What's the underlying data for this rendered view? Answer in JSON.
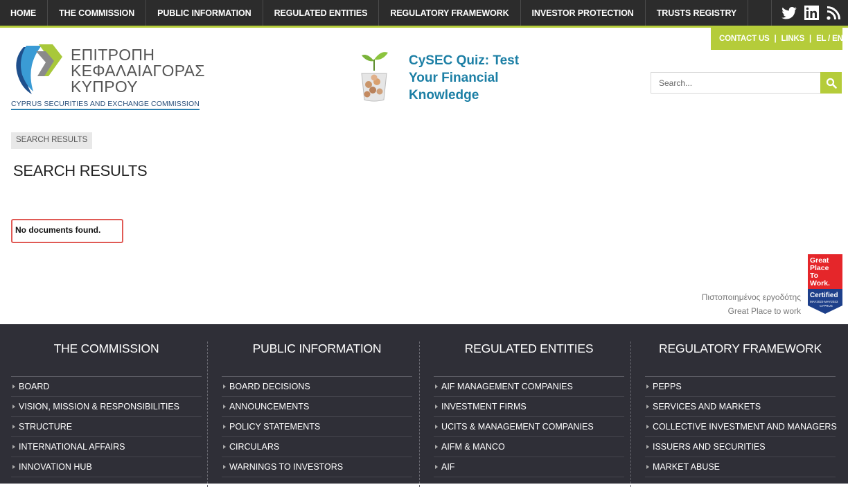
{
  "nav": {
    "items": [
      "HOME",
      "THE COMMISSION",
      "PUBLIC INFORMATION",
      "REGULATED ENTITIES",
      "REGULATORY FRAMEWORK",
      "INVESTOR PROTECTION",
      "TRUSTS REGISTRY"
    ],
    "social_icons": [
      "twitter-icon",
      "linkedin-icon",
      "rss-icon"
    ]
  },
  "logo": {
    "greek_line1": "ΕΠΙΤΡΟΠΗ",
    "greek_line2": "ΚΕΦΑΛΑΙΑΓΟΡΑΣ",
    "greek_line3": "ΚΥΠΡΟΥ",
    "english": "CYPRUS SECURITIES AND EXCHANGE COMMISSION"
  },
  "quiz": {
    "line1": "CySEC Quiz: Test",
    "line2": "Your Financial",
    "line3": "Knowledge"
  },
  "contact_bar": {
    "contact": "CONTACT US",
    "links": "LINKS",
    "lang": "EL / EN"
  },
  "search": {
    "placeholder": "Search..."
  },
  "breadcrumb": "SEARCH RESULTS",
  "page_title": "SEARCH RESULTS",
  "message": "No documents found.",
  "gptw": {
    "line1": "Πιστοποιημένος εργοδότης",
    "line2": "Great Place to work",
    "badge_top": "Great Place To Work.",
    "badge_mid": "Certified",
    "badge_dates": "MAY2022-MAY2023",
    "badge_country": "CYPRUS",
    "colors": {
      "red": "#e5262a",
      "blue": "#1d3f8a"
    }
  },
  "footer": {
    "columns": [
      {
        "title": "THE COMMISSION",
        "items": [
          "BOARD",
          "VISION, MISSION & RESPONSIBILITIES",
          "STRUCTURE",
          "INTERNATIONAL AFFAIRS",
          "INNOVATION HUB"
        ]
      },
      {
        "title": "PUBLIC INFORMATION",
        "items": [
          "BOARD DECISIONS",
          "ANNOUNCEMENTS",
          "POLICY STATEMENTS",
          "CIRCULARS",
          "WARNINGS TO INVESTORS"
        ]
      },
      {
        "title": "REGULATED ENTITIES",
        "items": [
          "AIF MANAGEMENT COMPANIES",
          "INVESTMENT FIRMS",
          "UCITS & MANAGEMENT COMPANIES",
          "AIFM & MANCO",
          "AIF"
        ]
      },
      {
        "title": "REGULATORY FRAMEWORK",
        "items": [
          "PEPPS",
          "SERVICES AND MARKETS",
          "COLLECTIVE INVESTMENT AND MANAGERS",
          "ISSUERS AND SECURITIES",
          "MARKET ABUSE"
        ]
      }
    ]
  },
  "colors": {
    "accent": "#b5cc3a",
    "nav_bg": "#2c2c2c",
    "footer_bg": "#2f2f37",
    "quiz_text": "#1c7fa5",
    "error_border": "#e05a55"
  }
}
